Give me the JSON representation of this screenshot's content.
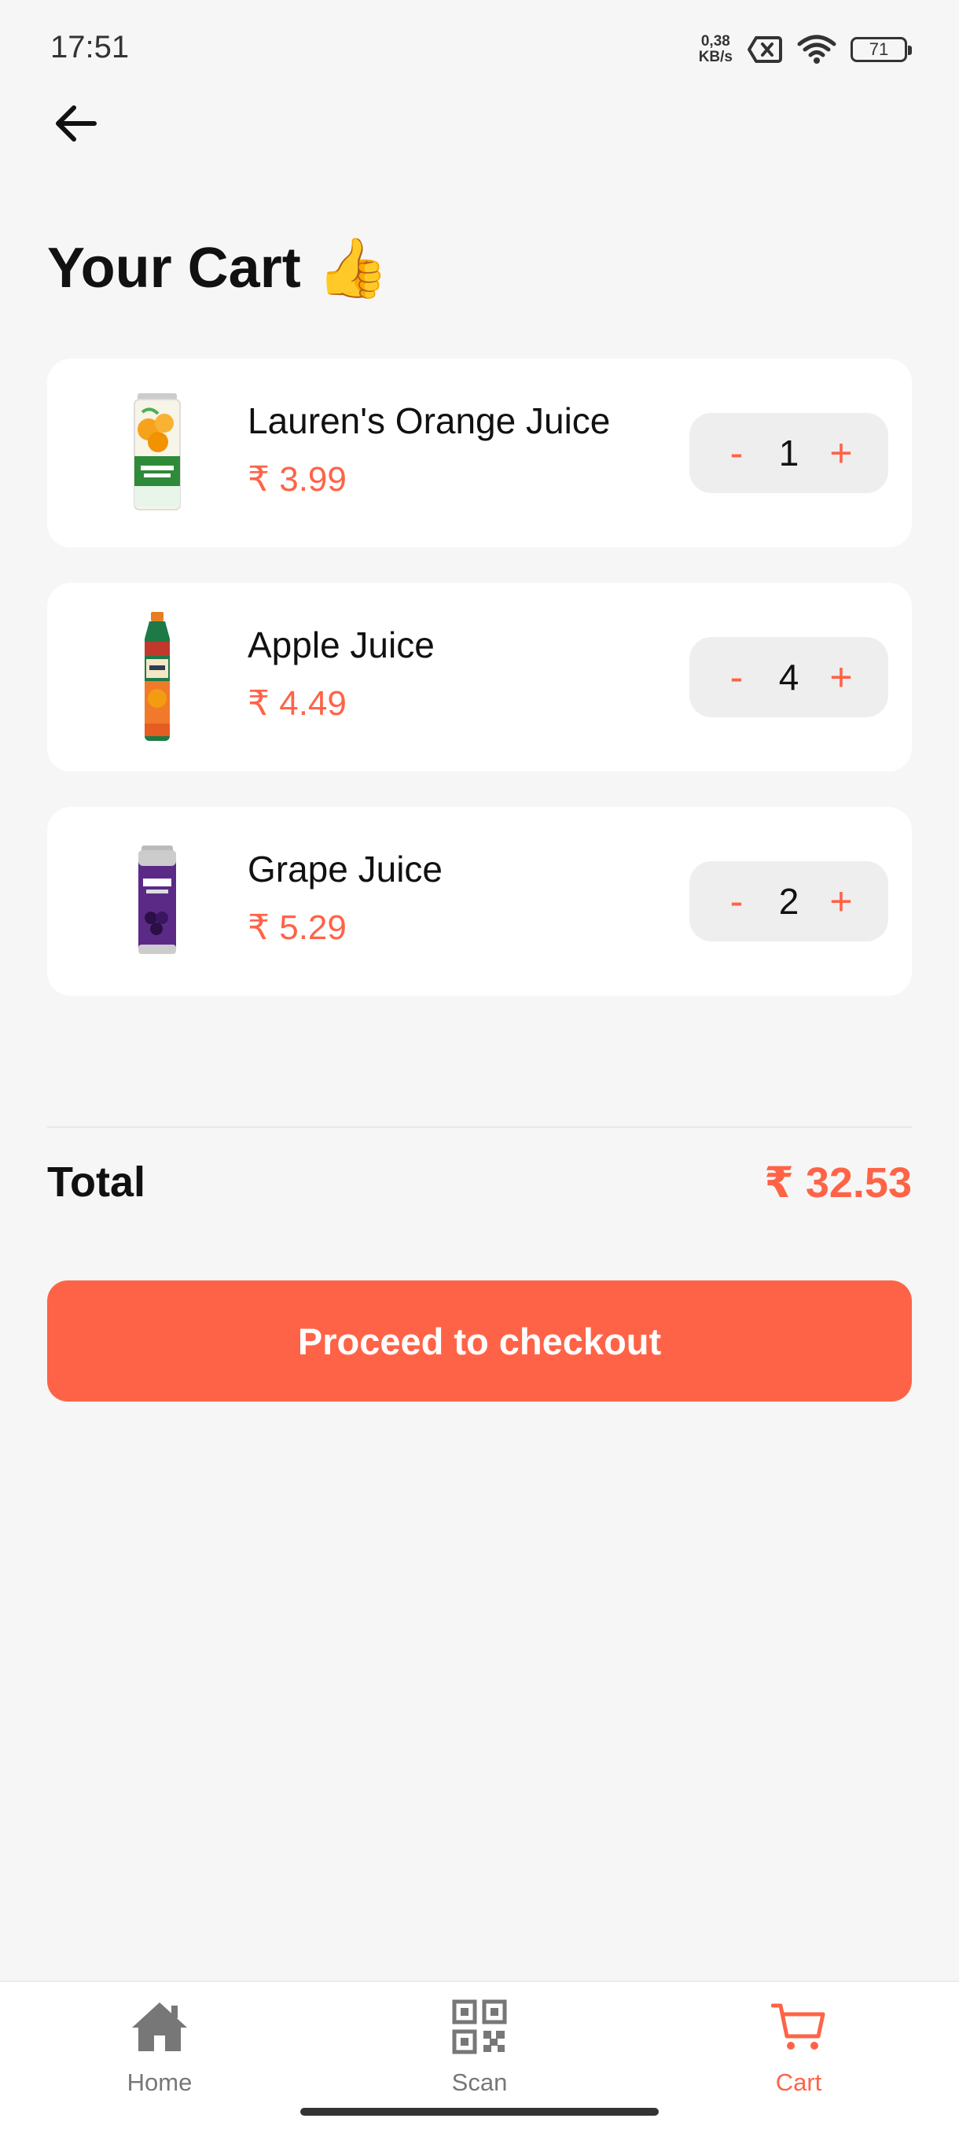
{
  "status_bar": {
    "time": "17:51",
    "net_speed_value": "0,38",
    "net_speed_unit": "KB/s",
    "battery": "71"
  },
  "header": {
    "back_icon": "arrow-left-icon",
    "title": "Your Cart",
    "title_emoji": "👍"
  },
  "cart": {
    "items": [
      {
        "name": "Lauren's Orange Juice",
        "price": "₹ 3.99",
        "quantity": "1",
        "minus_label": "-",
        "plus_label": "+",
        "image": "orange-juice-carton"
      },
      {
        "name": "Apple Juice",
        "price": "₹ 4.49",
        "quantity": "4",
        "minus_label": "-",
        "plus_label": "+",
        "image": "apple-juice-bottle"
      },
      {
        "name": "Grape Juice",
        "price": "₹ 5.29",
        "quantity": "2",
        "minus_label": "-",
        "plus_label": "+",
        "image": "grape-juice-can"
      }
    ]
  },
  "summary": {
    "total_label": "Total",
    "total_value": "₹ 32.53"
  },
  "checkout": {
    "label": "Proceed to checkout"
  },
  "bottom_nav": {
    "items": [
      {
        "label": "Home",
        "icon": "home-icon",
        "active": false
      },
      {
        "label": "Scan",
        "icon": "qr-code-icon",
        "active": false
      },
      {
        "label": "Cart",
        "icon": "cart-icon",
        "active": true
      }
    ]
  },
  "colors": {
    "accent": "#ff6347",
    "background": "#f6f6f6",
    "card": "#ffffff",
    "stepper_bg": "#eeeeee",
    "inactive_nav": "#777777"
  }
}
